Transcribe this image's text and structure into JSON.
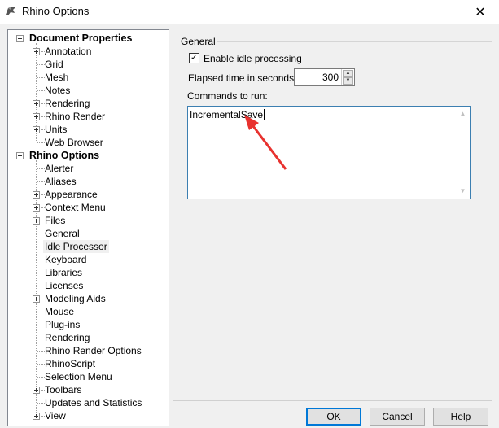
{
  "window": {
    "title": "Rhino Options",
    "close_glyph": "✕",
    "icon": "rhino-app-icon"
  },
  "tree": {
    "document_properties": {
      "label": "Document Properties",
      "children": [
        "Annotation",
        "Grid",
        "Mesh",
        "Notes",
        "Rendering",
        "Rhino Render",
        "Units",
        "Web Browser"
      ],
      "expandable": [
        true,
        false,
        false,
        false,
        true,
        true,
        true,
        false
      ]
    },
    "rhino_options": {
      "label": "Rhino Options",
      "children": [
        "Alerter",
        "Aliases",
        "Appearance",
        "Context Menu",
        "Files",
        "General",
        "Idle Processor",
        "Keyboard",
        "Libraries",
        "Licenses",
        "Modeling Aids",
        "Mouse",
        "Plug-ins",
        "Rendering",
        "Rhino Render Options",
        "RhinoScript",
        "Selection Menu",
        "Toolbars",
        "Updates and Statistics",
        "View"
      ],
      "expandable": [
        false,
        false,
        true,
        true,
        true,
        false,
        false,
        false,
        false,
        false,
        true,
        false,
        false,
        false,
        false,
        false,
        false,
        true,
        false,
        true
      ],
      "selected": "Idle Processor"
    }
  },
  "general": {
    "group_label": "General",
    "enable_idle_label": "Enable idle processing",
    "enable_idle_checked": true,
    "check_glyph": "✓",
    "elapsed_label": "Elapsed time in seconds:",
    "elapsed_value": "300",
    "commands_label": "Commands to run:",
    "commands_value": "IncrementalSave"
  },
  "buttons": {
    "ok": "OK",
    "cancel": "Cancel",
    "help": "Help"
  },
  "colors": {
    "annotation_arrow": "#e8322f",
    "focus_border": "#0078d7"
  }
}
